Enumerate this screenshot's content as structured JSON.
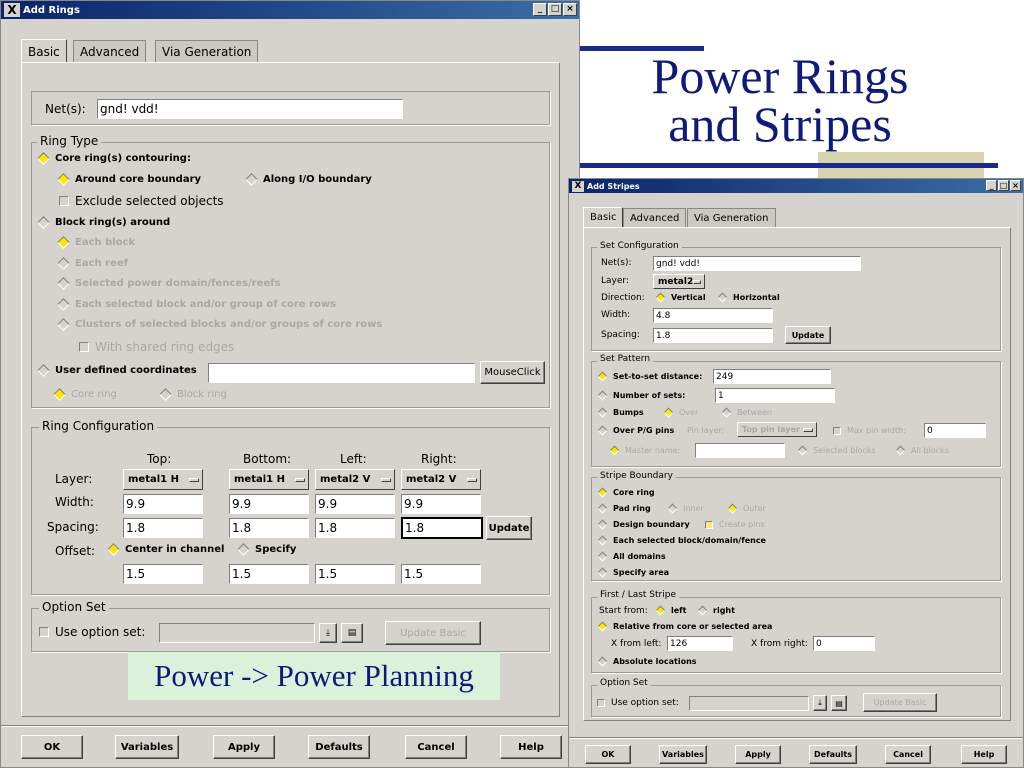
{
  "slide": {
    "title_line1": "Power Rings",
    "title_line2": "and Stripes",
    "caption": "Power -> Power Planning"
  },
  "colors": {
    "title_blue": "#0d1a7a",
    "accent_bar": "#1a2a8a",
    "olive": "#d8d4b0",
    "caption_bg": "#d9f2d9"
  },
  "rings": {
    "title": "Add Rings",
    "tabs": [
      "Basic",
      "Advanced",
      "Via Generation"
    ],
    "nets_label": "Net(s):",
    "nets_value": "gnd! vdd!",
    "ring_type": {
      "label": "Ring Type",
      "core_ring": "Core ring(s) contouring:",
      "around_core": "Around core boundary",
      "along_io": "Along I/O boundary",
      "exclude": "Exclude selected objects",
      "block_ring": "Block ring(s) around",
      "each_block": "Each block",
      "each_reef": "Each reef",
      "selected_power": "Selected power domain/fences/reefs",
      "each_selected": "Each selected block and/or group of core rows",
      "clusters": "Clusters of selected blocks and/or groups of core rows",
      "shared_edges": "With shared ring edges",
      "user_defined": "User defined coordinates",
      "mouse_click": "MouseClick",
      "core_ring_opt": "Core ring",
      "block_ring_opt": "Block ring"
    },
    "ring_config": {
      "label": "Ring Configuration",
      "cols": [
        "Top:",
        "Bottom:",
        "Left:",
        "Right:"
      ],
      "layer_label": "Layer:",
      "layers": [
        "metal1 H",
        "metal1 H",
        "metal2 V",
        "metal2 V"
      ],
      "width_label": "Width:",
      "widths": [
        "9.9",
        "9.9",
        "9.9",
        "9.9"
      ],
      "spacing_label": "Spacing:",
      "spacings": [
        "1.8",
        "1.8",
        "1.8",
        "1.8"
      ],
      "update": "Update",
      "offset_label": "Offset:",
      "center": "Center in channel",
      "specify": "Specify",
      "offsets": [
        "1.5",
        "1.5",
        "1.5",
        "1.5"
      ]
    },
    "option_set": {
      "label": "Option Set",
      "use": "Use option set:",
      "update_basic": "Update Basic"
    },
    "buttons": [
      "OK",
      "Variables",
      "Apply",
      "Defaults",
      "Cancel",
      "Help"
    ]
  },
  "stripes": {
    "title": "Add Stripes",
    "tabs": [
      "Basic",
      "Advanced",
      "Via Generation"
    ],
    "set_config": {
      "label": "Set Configuration",
      "nets_label": "Net(s):",
      "nets_value": "gnd! vdd!",
      "layer_label": "Layer:",
      "layer_value": "metal2",
      "direction_label": "Direction:",
      "vertical": "Vertical",
      "horizontal": "Horizontal",
      "width_label": "Width:",
      "width_value": "4.8",
      "spacing_label": "Spacing:",
      "spacing_value": "1.8",
      "update": "Update"
    },
    "set_pattern": {
      "label": "Set Pattern",
      "set_to_set": "Set-to-set distance:",
      "set_to_set_value": "249",
      "num_sets": "Number of sets:",
      "num_sets_value": "1",
      "bumps": "Bumps",
      "over": "Over",
      "between": "Between",
      "over_pg": "Over P/G pins",
      "pin_layer": "Pin layer:",
      "pin_layer_value": "Top pin layer",
      "max_pin": "Max pin width:",
      "max_pin_value": "0",
      "master_name": "Master name:",
      "selected_blocks": "Selected blocks",
      "all_blocks": "All blocks"
    },
    "stripe_boundary": {
      "label": "Stripe Boundary",
      "core_ring": "Core ring",
      "pad_ring": "Pad ring",
      "inner": "Inner",
      "outer": "Outer",
      "design_boundary": "Design boundary",
      "create_pins": "Create pins",
      "each_selected": "Each selected block/domain/fence",
      "all_domains": "All domains",
      "specify_area": "Specify area"
    },
    "first_last": {
      "label": "First / Last Stripe",
      "start_from": "Start from:",
      "left": "left",
      "right": "right",
      "relative": "Relative from core or selected area",
      "x_from_left": "X from left:",
      "x_left_value": "126",
      "x_from_right": "X from right:",
      "x_right_value": "0",
      "absolute": "Absolute locations"
    },
    "option_set": {
      "label": "Option Set",
      "use": "Use option set:",
      "update_basic": "Update Basic"
    },
    "buttons": [
      "OK",
      "Variables",
      "Apply",
      "Defaults",
      "Cancel",
      "Help"
    ]
  }
}
